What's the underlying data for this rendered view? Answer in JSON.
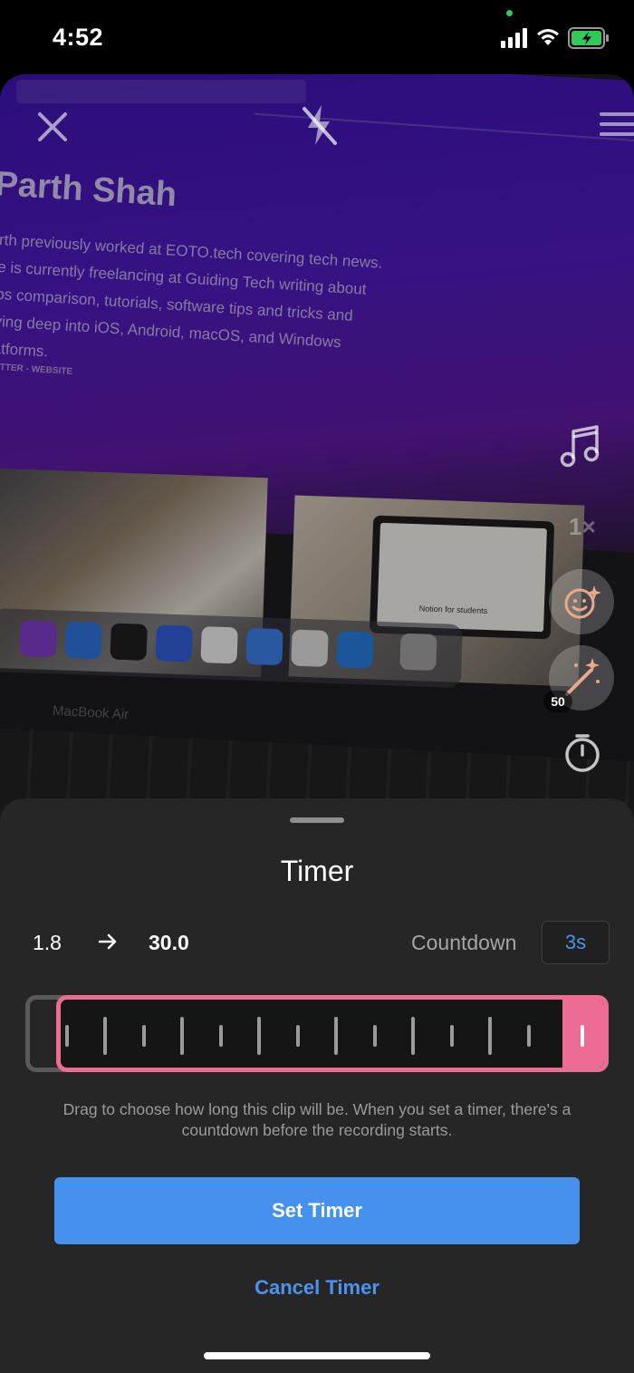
{
  "status_bar": {
    "time": "4:52"
  },
  "camera": {
    "article": {
      "author": "Parth Shah",
      "bio_lines": [
        "rth previously worked at EOTO.tech covering tech news.",
        "e is currently freelancing at Guiding Tech writing about",
        "ps comparison, tutorials, software tips and tricks and",
        "ving deep into iOS, Android, macOS, and Windows",
        "atforms."
      ],
      "links": "TTER - WEBSITE"
    },
    "laptop_caption": "Notion for students",
    "device_label": "MacBook Air",
    "controls": {
      "speed": "1×",
      "effect_count": "50"
    }
  },
  "timer": {
    "title": "Timer",
    "range_start": "1.8",
    "range_end": "30.0",
    "countdown_label": "Countdown",
    "countdown_value": "3s",
    "help_text": "Drag to choose how long this clip will be. When you set a timer, there's a countdown before the recording starts.",
    "set_button": "Set Timer",
    "cancel_button": "Cancel Timer"
  },
  "colors": {
    "accent_blue": "#4591eb",
    "slider_pink": "#ec6c93",
    "sheet_background": "#262626"
  }
}
